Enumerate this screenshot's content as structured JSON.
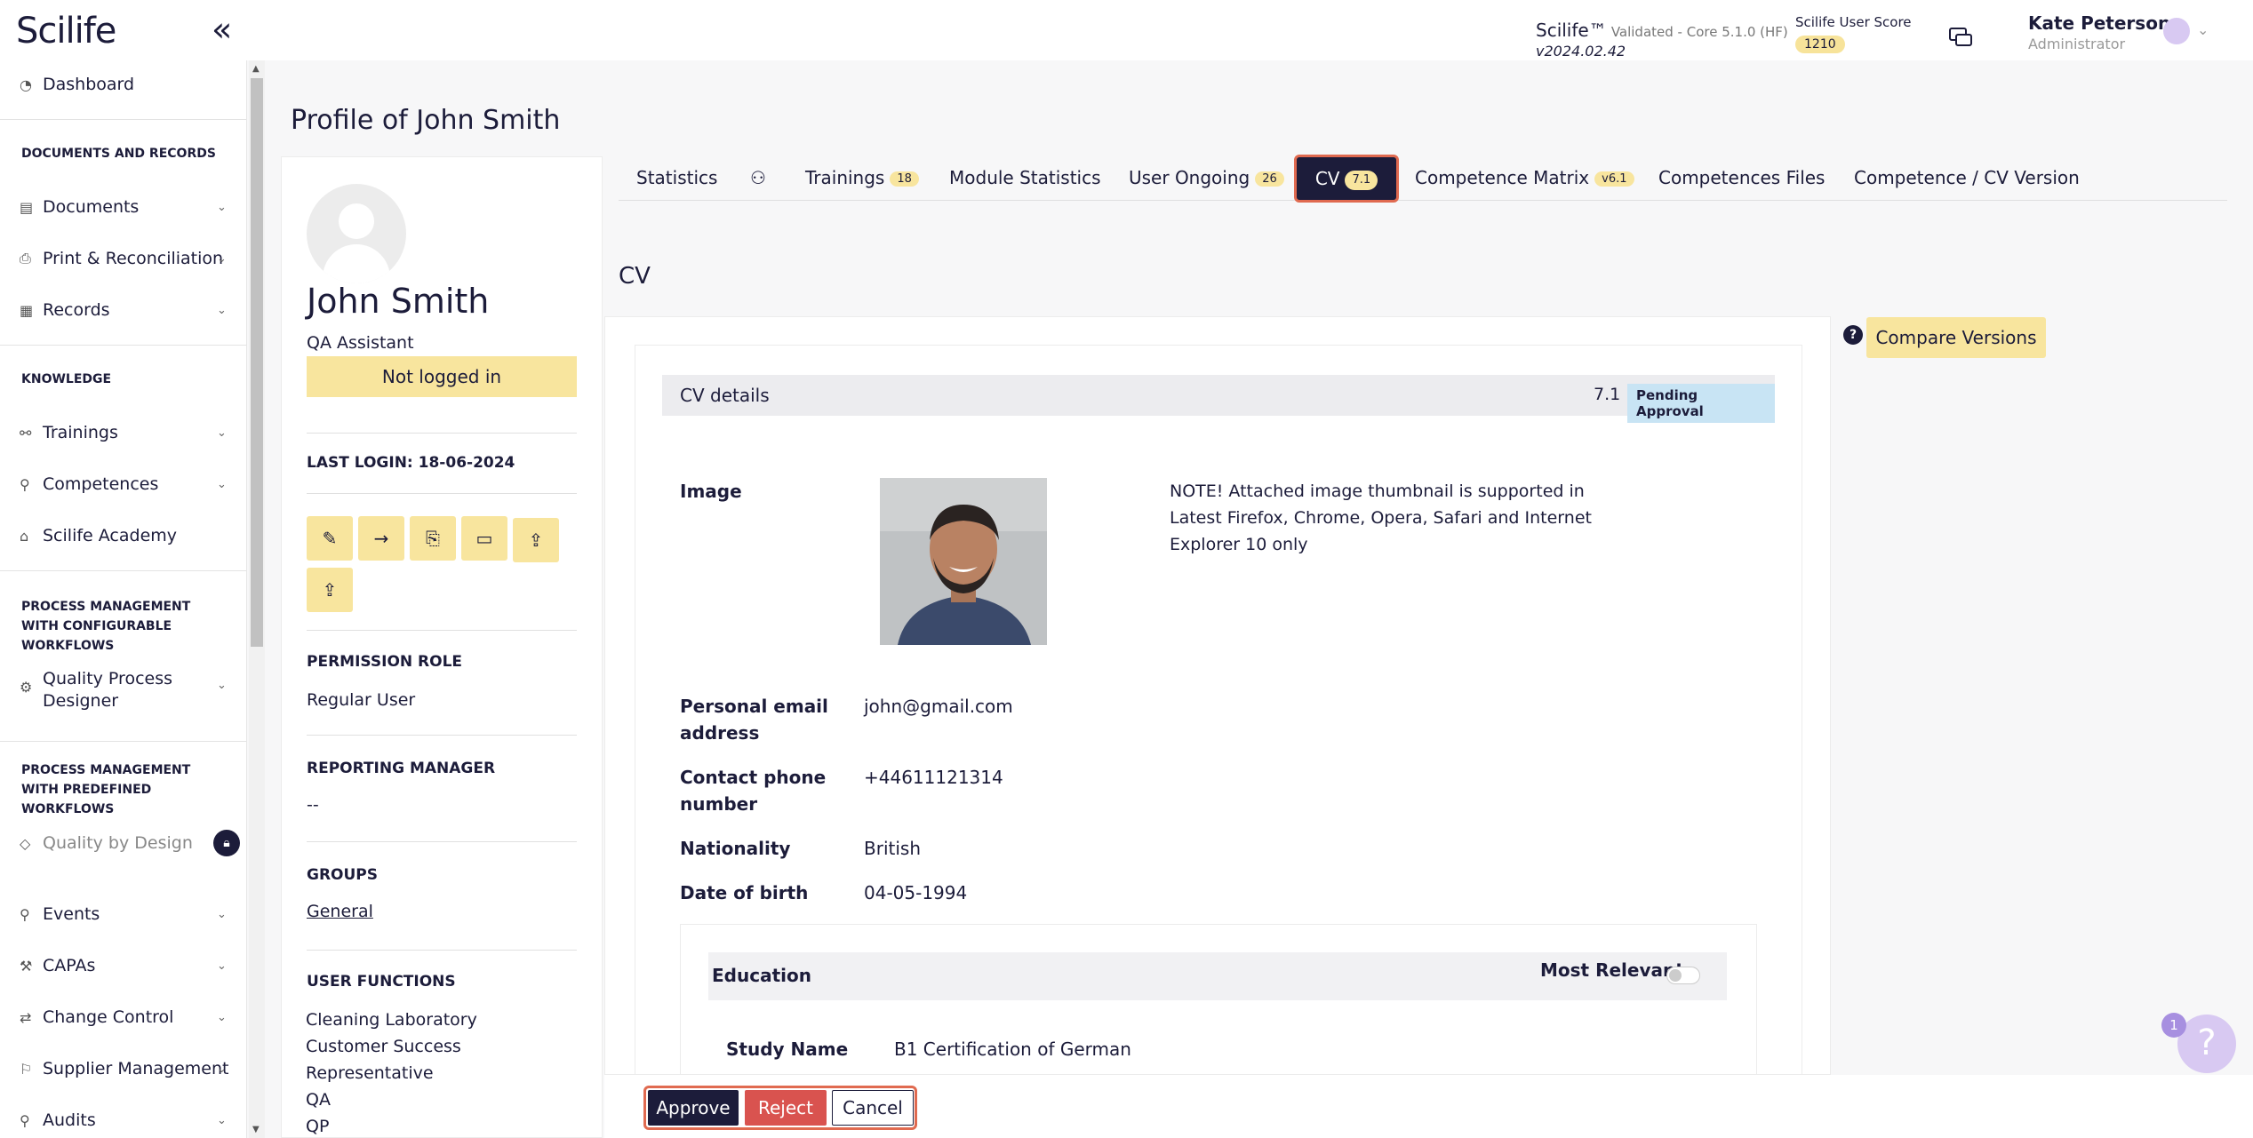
{
  "app": {
    "logo": "Scilife",
    "brand": "Scilife™",
    "validated": "Validated - Core 5.1.0 (HF)",
    "version": "v2024.02.42",
    "score_label": "Scilife User Score",
    "score_value": "1210",
    "user_name": "Kate Peterson",
    "user_role": "Administrator"
  },
  "sidebar": {
    "dashboard": "Dashboard",
    "sec_docs": "DOCUMENTS AND RECORDS",
    "documents": "Documents",
    "print": "Print & Reconciliation",
    "records": "Records",
    "sec_knowledge": "KNOWLEDGE",
    "trainings": "Trainings",
    "competences": "Competences",
    "academy": "Scilife Academy",
    "sec_configurable": "PROCESS MANAGEMENT WITH CONFIGURABLE WORKFLOWS",
    "qpd": "Quality Process Designer",
    "sec_predefined": "PROCESS MANAGEMENT WITH PREDEFINED WORKFLOWS",
    "qbd": "Quality by Design",
    "events": "Events",
    "capas": "CAPAs",
    "change_control": "Change Control",
    "supplier": "Supplier Management",
    "audits": "Audits"
  },
  "page": {
    "title": "Profile of John Smith",
    "cv_heading": "CV"
  },
  "profile": {
    "name": "John Smith",
    "job_title": "QA Assistant",
    "status": "Not logged in",
    "last_login": "LAST LOGIN: 18-06-2024",
    "permission_label": "PERMISSION ROLE",
    "permission_value": "Regular User",
    "manager_label": "REPORTING MANAGER",
    "manager_value": "--",
    "groups_label": "GROUPS",
    "groups_value": "General",
    "functions_label": "USER FUNCTIONS",
    "functions": [
      "Cleaning Laboratory",
      "Customer Success",
      "Representative",
      "QA",
      "QP"
    ]
  },
  "tabs": {
    "statistics": "Statistics",
    "trainings": "Trainings",
    "trainings_count": "18",
    "module_statistics": "Module Statistics",
    "user_ongoing": "User Ongoing",
    "user_ongoing_count": "26",
    "cv": "CV",
    "cv_count": "7.1",
    "competence_matrix": "Competence Matrix",
    "competence_matrix_count": "v6.1",
    "competences_files": "Competences Files",
    "competence_cv_version": "Competence / CV Version"
  },
  "cv": {
    "details_title": "CV details",
    "version": "7.1 |",
    "status": "Pending Approval",
    "image_label": "Image",
    "note": "NOTE! Attached image thumbnail is supported in Latest Firefox, Chrome, Opera, Safari and Internet Explorer 10 only",
    "email_label": "Personal email address",
    "email_value": "john@gmail.com",
    "phone_label": "Contact phone number",
    "phone_value": "+44611121314",
    "nationality_label": "Nationality",
    "nationality_value": "British",
    "dob_label": "Date of birth",
    "dob_value": "04-05-1994",
    "education_title": "Education",
    "most_relevant": "Most Relevant",
    "study_label": "Study Name",
    "study_value": "B1 Certification of German",
    "compare_button": "Compare Versions"
  },
  "actions": {
    "approve": "Approve",
    "reject": "Reject",
    "cancel": "Cancel"
  },
  "help_badge": "1",
  "colors": {
    "primary": "#1c1c3a",
    "accent_yellow": "#f8e59e",
    "reject": "#d9534f",
    "highlight": "#e06a50"
  }
}
